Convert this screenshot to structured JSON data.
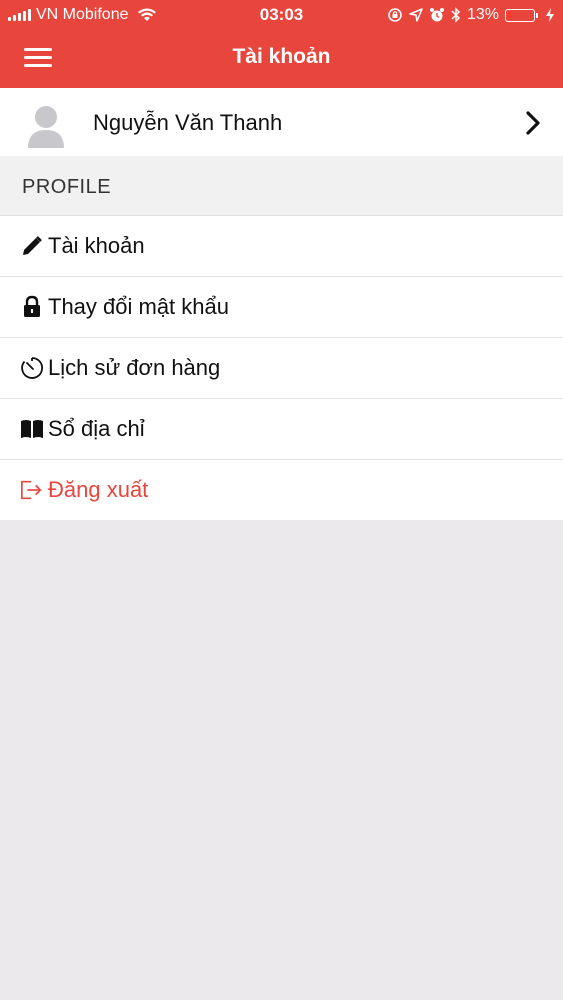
{
  "status_bar": {
    "carrier": "VN Mobifone",
    "time": "03:03",
    "battery": "13%"
  },
  "header": {
    "title": "Tài khoản",
    "menu_icon": "hamburger-menu-icon"
  },
  "profile": {
    "name": "Nguyễn Văn Thanh",
    "avatar_icon": "user-avatar-icon",
    "chevron_icon": "chevron-right-icon"
  },
  "section": {
    "title": "PROFILE"
  },
  "menu": {
    "items": [
      {
        "label": "Tài khoản",
        "icon": "pencil-icon"
      },
      {
        "label": "Thay đổi mật khẩu",
        "icon": "lock-icon"
      },
      {
        "label": "Lịch sử đơn hàng",
        "icon": "timer-icon"
      },
      {
        "label": "Sổ địa chỉ",
        "icon": "book-icon"
      },
      {
        "label": "Đăng xuất",
        "icon": "logout-icon"
      }
    ]
  },
  "colors": {
    "accent": "#e8453c",
    "background": "#ebe9eb"
  }
}
